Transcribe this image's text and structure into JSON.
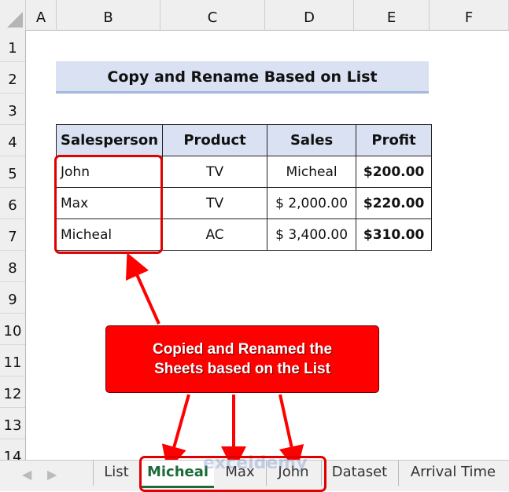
{
  "columns": [
    "A",
    "B",
    "C",
    "D",
    "E",
    "F"
  ],
  "rows": [
    "1",
    "2",
    "3",
    "4",
    "5",
    "6",
    "7",
    "8",
    "9",
    "10",
    "11",
    "12",
    "13",
    "14"
  ],
  "title": "Copy and Rename Based on List",
  "table": {
    "headers": [
      "Salesperson",
      "Product",
      "Sales",
      "Profit"
    ],
    "rows": [
      [
        "John",
        "TV",
        "Micheal",
        "$200.00"
      ],
      [
        "Max",
        "TV",
        "$ 2,000.00",
        "$220.00"
      ],
      [
        "Micheal",
        "AC",
        "$ 3,400.00",
        "$310.00"
      ]
    ]
  },
  "callout": {
    "line1": "Copied and Renamed the",
    "line2": "Sheets based on the List"
  },
  "sheet_tabs": [
    {
      "label": "List",
      "active": false
    },
    {
      "label": "Micheal",
      "active": true
    },
    {
      "label": "Max",
      "active": false
    },
    {
      "label": "John",
      "active": false
    },
    {
      "label": "Dataset",
      "active": false
    },
    {
      "label": "Arrival Time",
      "active": false
    }
  ],
  "nav": {
    "prev": "◀",
    "next": "▶"
  },
  "watermark": "exceldemy",
  "colors": {
    "accent_red": "#ff0000",
    "active_tab": "#1d6b3a",
    "header_fill": "#d9e1f2"
  }
}
